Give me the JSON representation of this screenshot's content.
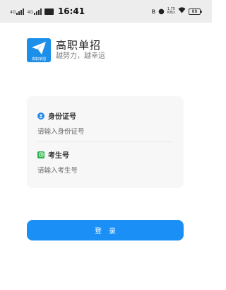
{
  "status_bar": {
    "signal_1": "4G",
    "signal_2": "4G",
    "time": "16:41",
    "bluetooth_icon": "bluetooth-icon",
    "alarm_icon": "alarm-icon",
    "speed_value": "1.75",
    "speed_unit": "KB/s",
    "wifi_icon": "wifi-icon",
    "battery": "88"
  },
  "brand": {
    "logo_caption": "高职单招",
    "title": "高职单招",
    "slogan": "越努力，越幸运",
    "accent": "#1e8fe8"
  },
  "form": {
    "id_field": {
      "icon": "person-icon",
      "label": "身份证号",
      "placeholder": "请输入身份证号",
      "icon_color": "#2b8cf0"
    },
    "exam_field": {
      "icon": "id-card-icon",
      "label": "考生号",
      "placeholder": "请输入考生号",
      "icon_color": "#27b24a"
    }
  },
  "actions": {
    "login_label": "登录",
    "button_color": "#1a8ff5"
  }
}
